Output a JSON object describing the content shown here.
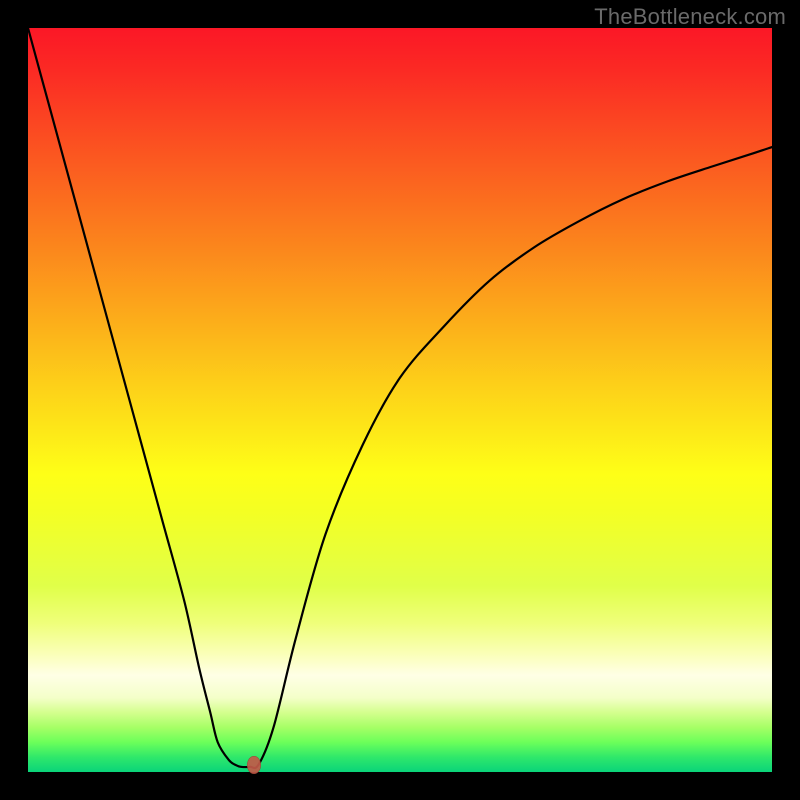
{
  "watermark": "TheBottleneck.com",
  "chart_data": {
    "type": "line",
    "title": "",
    "xlabel": "",
    "ylabel": "",
    "xlim": [
      0,
      100
    ],
    "ylim": [
      0,
      100
    ],
    "grid": false,
    "series": [
      {
        "name": "curve",
        "x": [
          0,
          3,
          6,
          9,
          12,
          15,
          18,
          21,
          23,
          24.5,
          25.5,
          27,
          28,
          28.6,
          29.8,
          31.0,
          33,
          36,
          40,
          45,
          50,
          56,
          62,
          68,
          74,
          80,
          86,
          92,
          97,
          100
        ],
        "y": [
          100,
          89,
          78,
          67,
          56,
          45,
          34,
          23,
          14,
          8,
          4,
          1.6,
          0.9,
          0.7,
          0.7,
          1.0,
          6,
          18,
          32,
          44,
          53,
          60,
          66,
          70.5,
          74,
          77,
          79.4,
          81.4,
          83,
          84
        ]
      }
    ],
    "flat_segment": {
      "x_start": 27.4,
      "x_end": 29.8,
      "y": 0.7
    },
    "marker": {
      "x": 30.4,
      "y": 0.9,
      "color": "#c25a48"
    },
    "background_gradient": {
      "direction": "top-to-bottom",
      "stops": [
        {
          "pos": 0.0,
          "color": "#fb1726"
        },
        {
          "pos": 0.3,
          "color": "#fb881c"
        },
        {
          "pos": 0.6,
          "color": "#feff17"
        },
        {
          "pos": 0.87,
          "color": "#ffffe6"
        },
        {
          "pos": 1.0,
          "color": "#0ad47a"
        }
      ]
    }
  }
}
